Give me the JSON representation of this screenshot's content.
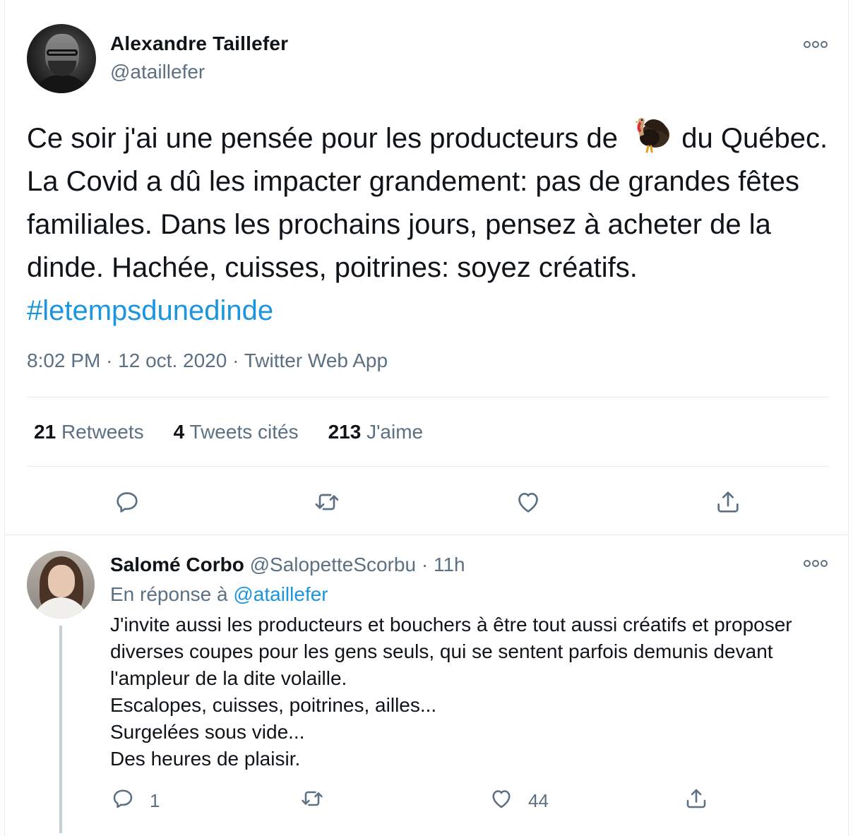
{
  "main_tweet": {
    "author_name": "Alexandre Taillefer",
    "author_handle": "@ataillefer",
    "text_before_emoji": "Ce soir j'ai une pensée pour les producteurs de ",
    "text_after_emoji": " du Québec. La Covid a dû les impacter grandement: pas de grandes fêtes familiales. Dans les prochains jours, pensez à acheter de la dinde. Hachée, cuisses, poitrines: soyez créatifs. ",
    "hashtag": "#letempsdunedinde",
    "emoji": "turkey-icon",
    "time": "8:02 PM",
    "date": "12 oct. 2020",
    "source": "Twitter Web App",
    "stats": {
      "retweets_count": "21",
      "retweets_label": "Retweets",
      "quotes_count": "4",
      "quotes_label": "Tweets cités",
      "likes_count": "213",
      "likes_label": "J'aime"
    }
  },
  "reply": {
    "author_name": "Salomé Corbo",
    "author_handle": "@SalopetteScorbu",
    "time": "11h",
    "replying_to_label": "En réponse à",
    "replying_to_handle": "@ataillefer",
    "text": "J'invite aussi les producteurs et bouchers à être tout aussi créatifs et proposer diverses coupes pour les gens seuls, qui se sentent parfois demunis devant l'ampleur de la dite volaille.\nEscalopes, cuisses, poitrines, ailles...\nSurgelées sous vide...\nDes heures de plaisir.",
    "reply_count": "1",
    "retweet_count": "",
    "like_count": "44"
  },
  "colors": {
    "text": "#0f1419",
    "secondary": "#5b7083",
    "link": "#1b95e0",
    "divider": "#e6ecf0"
  }
}
